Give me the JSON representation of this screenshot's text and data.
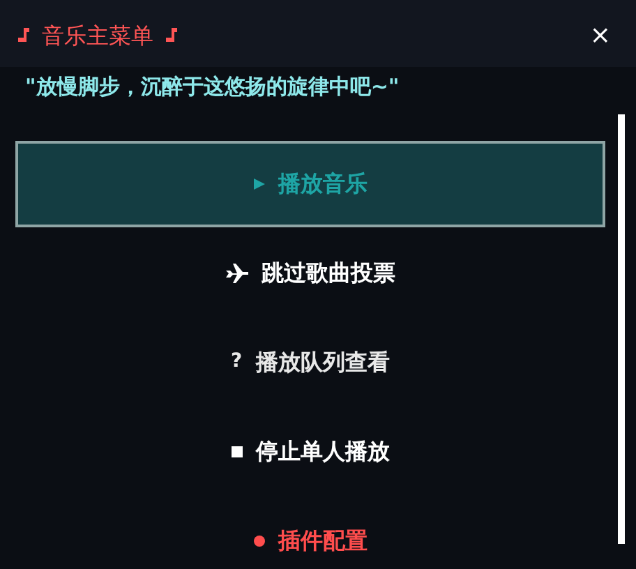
{
  "window": {
    "title": "音乐主菜单",
    "close": "×"
  },
  "subtitle": "\"放慢脚步，沉醉于这悠扬的旋律中吧~\"",
  "menu": [
    {
      "kind": "play",
      "label": "播放音乐",
      "selected": true,
      "color": "#1ea5a5"
    },
    {
      "kind": "plane",
      "label": "跳过歌曲投票",
      "selected": false,
      "color": "#ffffff"
    },
    {
      "kind": "glyph",
      "glyph": "?",
      "label": "播放队列查看",
      "selected": false,
      "color": "#e8e8e8"
    },
    {
      "kind": "square",
      "label": "停止单人播放",
      "selected": false,
      "color": "#ffffff"
    },
    {
      "kind": "dot",
      "label": "插件配置",
      "selected": false,
      "color": "#ff4d4d"
    }
  ]
}
